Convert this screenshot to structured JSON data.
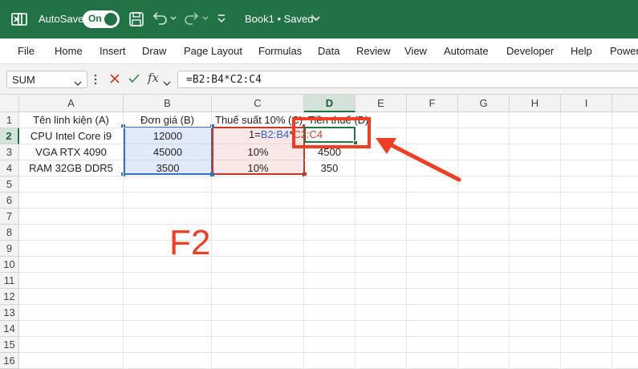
{
  "titlebar": {
    "autosave_label": "AutoSave",
    "autosave_state": "On",
    "doc_title": "Book1 • Saved",
    "brand_color": "#217346"
  },
  "ribbon": {
    "tabs": [
      "File",
      "Home",
      "Insert",
      "Draw",
      "Page Layout",
      "Formulas",
      "Data",
      "Review",
      "View",
      "Automate",
      "Developer",
      "Help",
      "Power"
    ]
  },
  "formula_bar": {
    "name_box": "SUM",
    "fx_label": "fx",
    "formula": "=B2:B4*C2:C4"
  },
  "columns": [
    "A",
    "B",
    "C",
    "D",
    "E",
    "F",
    "G",
    "H",
    "I"
  ],
  "active_column": "D",
  "rows": [
    "1",
    "2",
    "3",
    "4",
    "5",
    "6",
    "7",
    "8",
    "9",
    "10",
    "11",
    "12",
    "13",
    "14",
    "15",
    "16"
  ],
  "active_row": "2",
  "cells": {
    "A1": "Tên linh kiện (A)",
    "B1": "Đơn giá (B)",
    "C1": "Thuế suất 10% (C)",
    "D1": "Tiền thuế (D)",
    "A2": "CPU Intel Core i9",
    "A3": "VGA RTX 4090",
    "A4": "RAM 32GB DDR5",
    "B2": "12000",
    "B3": "45000",
    "B4": "3500",
    "C2_prefix": "1",
    "C3": "10%",
    "C4": "10%",
    "D3": "4500",
    "D4": "350"
  },
  "edit_tokens": {
    "eq": "=",
    "ref_b": "B2:B4",
    "op": "*",
    "ref_c": "C2:C4"
  },
  "annotation": {
    "label": "F2",
    "color": "#ef3e23"
  }
}
